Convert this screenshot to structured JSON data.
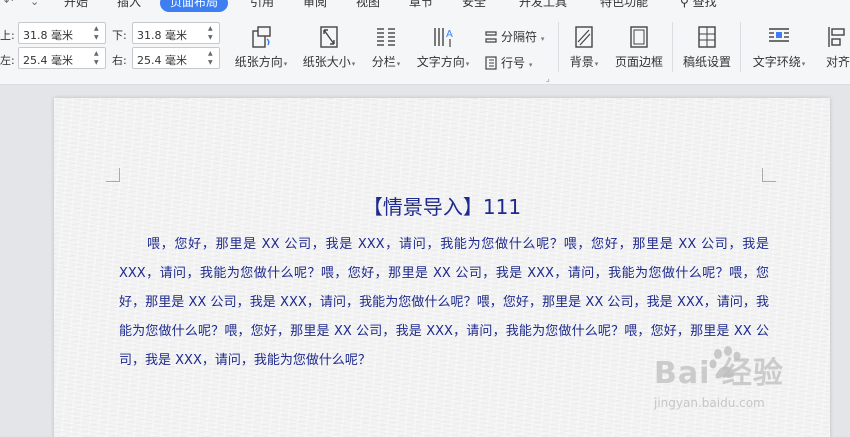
{
  "tabs": [
    {
      "label": "开始",
      "active": false
    },
    {
      "label": "插入",
      "active": false
    },
    {
      "label": "页面布局",
      "active": true
    },
    {
      "label": "引用",
      "active": false
    },
    {
      "label": "审阅",
      "active": false
    },
    {
      "label": "视图",
      "active": false
    },
    {
      "label": "章节",
      "active": false
    },
    {
      "label": "安全",
      "active": false
    },
    {
      "label": "开发工具",
      "active": false
    },
    {
      "label": "特色功能",
      "active": false
    }
  ],
  "search_label": "查找",
  "margins": {
    "top_label": "上:",
    "top_value": "31.8 毫米",
    "bottom_label": "下:",
    "bottom_value": "31.8 毫米",
    "left_label": "左:",
    "left_value": "25.4 毫米",
    "right_label": "右:",
    "right_value": "25.4 毫米"
  },
  "ribbon": {
    "orientation": "纸张方向",
    "size": "纸张大小",
    "columns": "分栏",
    "text_direction": "文字方向",
    "separator": "分隔符",
    "line_number": "行号",
    "background": "背景",
    "page_border": "页面边框",
    "manuscript": "稿纸设置",
    "text_wrap": "文字环绕",
    "align": "对齐"
  },
  "document": {
    "title": "【情景导入】111",
    "paragraph": "喂，您好，那里是 XX 公司，我是 XXX，请问，我能为您做什么呢？喂，您好，那里是 XX 公司，我是 XXX，请问，我能为您做什么呢？喂，您好，那里是 XX 公司，我是 XXX，请问，我能为您做什么呢？喂，您好，那里是 XX 公司，我是 XXX，请问，我能为您做什么呢？喂，您好，那里是 XX 公司，我是 XXX，请问，我能为您做什么呢？喂，您好，那里是 XX 公司，我是 XXX，请问，我能为您做什么呢？喂，您好，那里是 XX 公司，我是 XXX，请问，我能为您做什么呢？"
  },
  "watermark": {
    "brand": "Bai  经验",
    "url": "jingyan.baidu.com"
  },
  "colors": {
    "accent": "#3d7ff2",
    "doc_text": "#1e2a8c"
  }
}
